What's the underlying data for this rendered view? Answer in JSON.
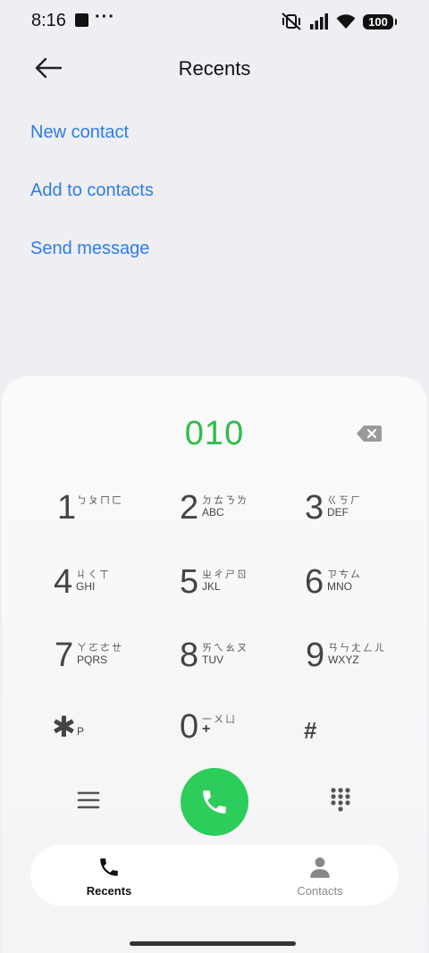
{
  "status_bar": {
    "time": "8:16",
    "dots": "···",
    "battery": "100"
  },
  "header": {
    "title": "Recents",
    "back_icon": "arrow-left-icon"
  },
  "actions": [
    {
      "label": "New contact"
    },
    {
      "label": "Add to contacts"
    },
    {
      "label": "Send message"
    }
  ],
  "dialer": {
    "number": "010",
    "keys": [
      {
        "digit": "1",
        "zhuyin": "ㄅㄆㄇㄈ",
        "letters": ""
      },
      {
        "digit": "2",
        "zhuyin": "ㄉㄊㄋㄌ",
        "letters": "ABC"
      },
      {
        "digit": "3",
        "zhuyin": "ㄍㄎㄏ",
        "letters": "DEF"
      },
      {
        "digit": "4",
        "zhuyin": "ㄐㄑㄒ",
        "letters": "GHI"
      },
      {
        "digit": "5",
        "zhuyin": "ㄓㄔㄕㄖ",
        "letters": "JKL"
      },
      {
        "digit": "6",
        "zhuyin": "ㄗㄘㄙ",
        "letters": "MNO"
      },
      {
        "digit": "7",
        "zhuyin": "ㄚㄛㄜㄝ",
        "letters": "PQRS"
      },
      {
        "digit": "8",
        "zhuyin": "ㄞㄟㄠㄡ",
        "letters": "TUV"
      },
      {
        "digit": "9",
        "zhuyin": "ㄢㄣㄤㄥㄦ",
        "letters": "WXYZ"
      },
      {
        "digit": "✱",
        "zhuyin": "",
        "letters": "P"
      },
      {
        "digit": "0",
        "zhuyin": "一ㄨㄩ",
        "letters": "+"
      },
      {
        "digit": "#",
        "zhuyin": "",
        "letters": ""
      }
    ]
  },
  "bottom_nav": {
    "recents_label": "Recents",
    "contacts_label": "Contacts"
  },
  "colors": {
    "accent_blue": "#2d7de8",
    "call_green": "#2dcd5c",
    "number_green": "#2dbd4a"
  }
}
